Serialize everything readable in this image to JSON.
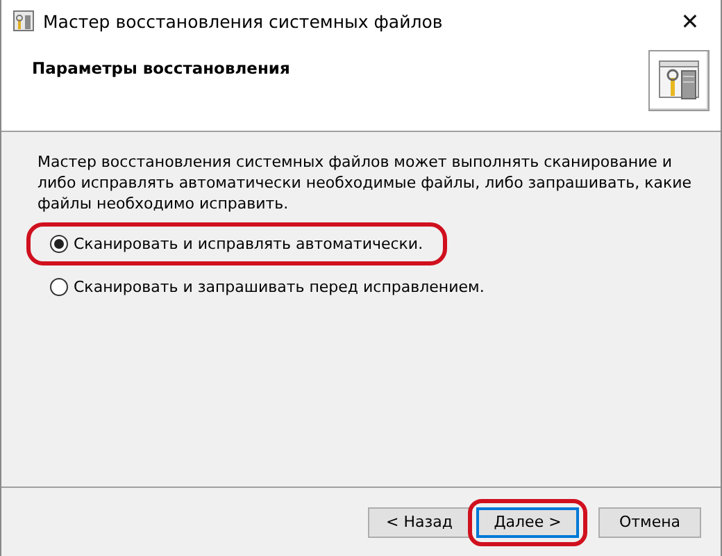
{
  "window": {
    "title": "Мастер восстановления системных файлов",
    "close": "✕"
  },
  "header": {
    "title": "Параметры восстановления"
  },
  "description": "Мастер восстановления системных файлов может выполнять сканирование и либо исправлять автоматически необходимые файлы, либо запрашивать, какие файлы необходимо исправить.",
  "options": [
    {
      "label": "Сканировать и исправлять автоматически.",
      "selected": true,
      "highlighted": true
    },
    {
      "label": "Сканировать и запрашивать перед исправлением.",
      "selected": false,
      "highlighted": false
    }
  ],
  "buttons": [
    {
      "label": "< Назад",
      "default": false,
      "highlighted": false
    },
    {
      "label": "Далее >",
      "default": true,
      "highlighted": true
    },
    {
      "label": "Отмена",
      "default": false,
      "highlighted": false
    }
  ]
}
